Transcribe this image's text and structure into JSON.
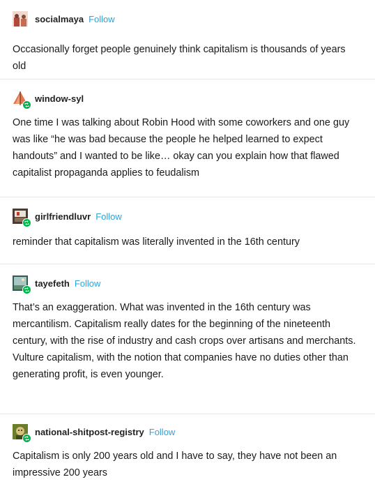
{
  "posts": [
    {
      "username": "socialmaya",
      "follow": "Follow",
      "avatar_icon": "avatar-two-figures-icon",
      "reblog": false,
      "text": "Occasionally forget people genuinely think capitalism is thousands of years old"
    },
    {
      "username": "window-syl",
      "follow": "",
      "avatar_icon": "avatar-sailboat-icon",
      "reblog": true,
      "text": "One time I was talking about Robin Hood with some coworkers and one guy was like “he was bad because the people he helped learned to expect handouts” and I wanted to be like… okay can you explain how that flawed capitalist propaganda applies to feudalism"
    },
    {
      "username": "girlfriendluvr",
      "follow": "Follow",
      "avatar_icon": "avatar-room-icon",
      "reblog": true,
      "text": "reminder that capitalism was literally invented in the 16th century"
    },
    {
      "username": "tayefeth",
      "follow": "Follow",
      "avatar_icon": "avatar-landscape-icon",
      "reblog": true,
      "text": "That’s an exaggeration. What was invented in the 16th century was mercantilism. Capitalism really dates for the beginning of the nineteenth century, with the rise of industry and cash crops over artisans and merchants. Vulture capitalism, with the notion that companies have no duties other than generating profit, is even younger."
    },
    {
      "username": "national-shitpost-registry",
      "follow": "Follow",
      "avatar_icon": "avatar-character-icon",
      "reblog": true,
      "text": "Capitalism is only 200 years old and I have to say, they have not been an impressive 200 years"
    }
  ],
  "colors": {
    "follow": "#2da3d8",
    "reblog_badge": "#00b34a",
    "divider": "#e5e5e5"
  }
}
